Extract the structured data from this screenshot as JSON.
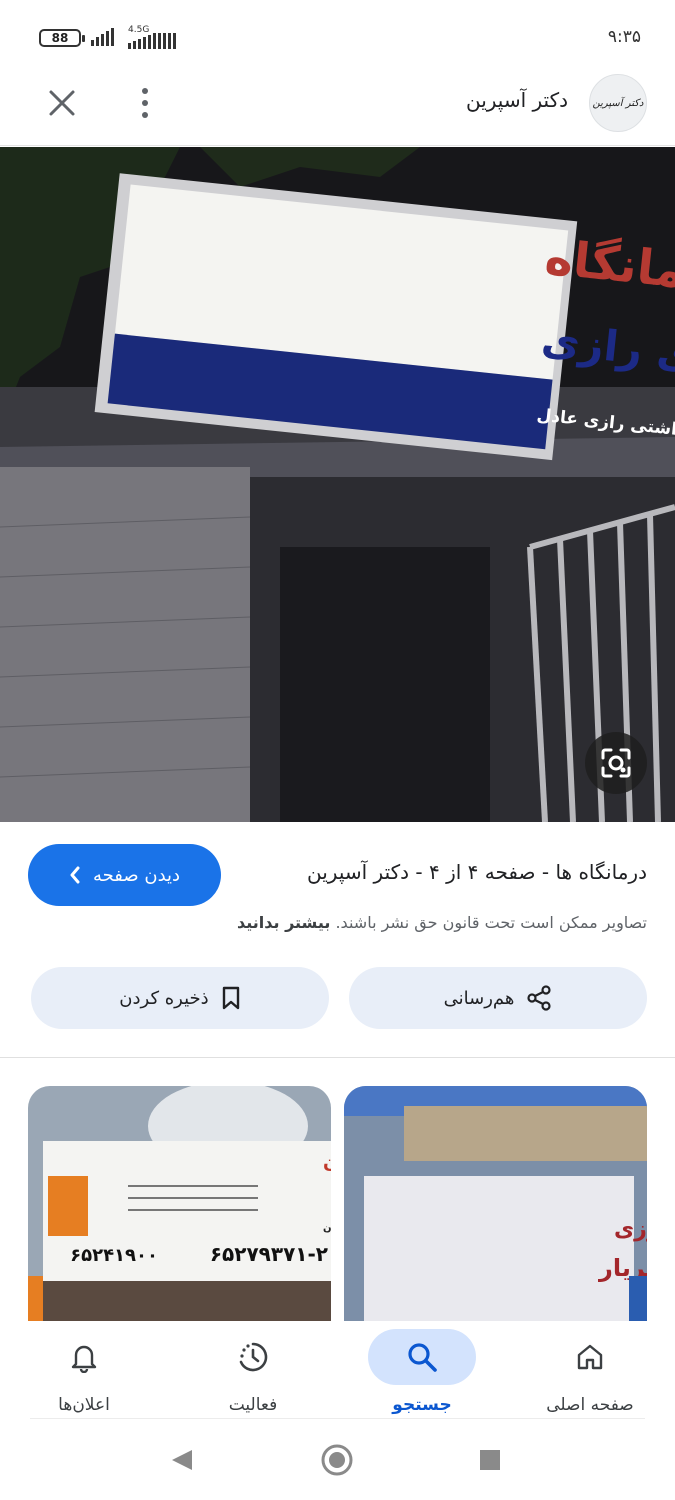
{
  "status_bar": {
    "battery": "88",
    "network": "4.5G",
    "time": "۹:۳۵"
  },
  "header": {
    "site_name": "دکتر آسپرین",
    "logo_text": "دکتر آسپرین"
  },
  "main_image": {
    "sign_line1": "درمانگاه",
    "sign_line2": "شبانه روزی رازی",
    "sign_line3": "شرکت تعاونی خدماتی،درمانی-بهداشتی رازی عادل"
  },
  "info": {
    "title": "درمانگاه ها - صفحه ۴ از ۴ - دکتر آسپرین",
    "view_page_label": "دیدن صفحه",
    "copyright_text": "تصاویر ممکن است تحت قانون حق نشر باشند.",
    "learn_more": "بیشتر بدانید"
  },
  "actions": {
    "share_label": "هم‌رسانی",
    "save_label": "ذخیره کردن"
  },
  "related": {
    "left_line1": "درمانگاه شبانه روزی ایران",
    "left_line2": "شهریار، ابتدای بلوار رسول اکرم ، خیابان آهنگران",
    "left_phone1": "۶۵۲۷۹۳۷۱-۲",
    "left_phone2": "۶۵۲۴۱۹۰۰",
    "right_line1": "درمانگاه شبانه روزی",
    "right_line2": "کیمیای شهریار"
  },
  "bottom_nav": {
    "items": [
      {
        "label": "صفحه اصلی",
        "icon": "home-icon"
      },
      {
        "label": "جستجو",
        "icon": "search-icon"
      },
      {
        "label": "فعالیت",
        "icon": "activity-icon"
      },
      {
        "label": "اعلان‌ها",
        "icon": "bell-icon"
      }
    ]
  },
  "colors": {
    "accent": "#1a73e8",
    "chip_bg": "#e8eef8",
    "nav_active_bg": "#d3e3fd"
  }
}
